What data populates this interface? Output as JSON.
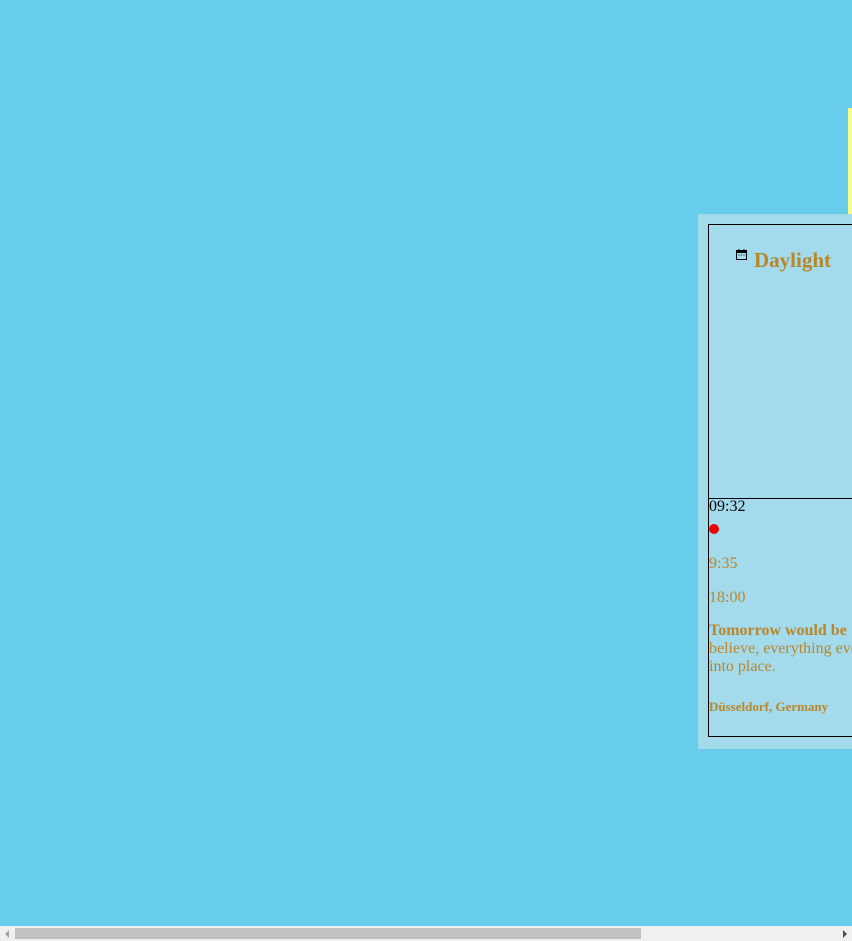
{
  "widget": {
    "title": "Daylight",
    "current_time": "09:32",
    "sunrise": "9:35",
    "sunset": "18:00",
    "message_bold": "Tomorrow would be",
    "message_rest_line1": "believe, everything eve",
    "message_rest_line2": "into place.",
    "location": "Düsseldorf, Germany"
  },
  "colors": {
    "page_background": "#67cdea",
    "card_background": "#a3dbec",
    "accent_text": "#b9862a",
    "indicator": "#ee0000",
    "highlight_strip": "#f7ff8c"
  },
  "icons": {
    "title_icon": "calendar-icon",
    "current_indicator": "red-dot-indicator"
  }
}
